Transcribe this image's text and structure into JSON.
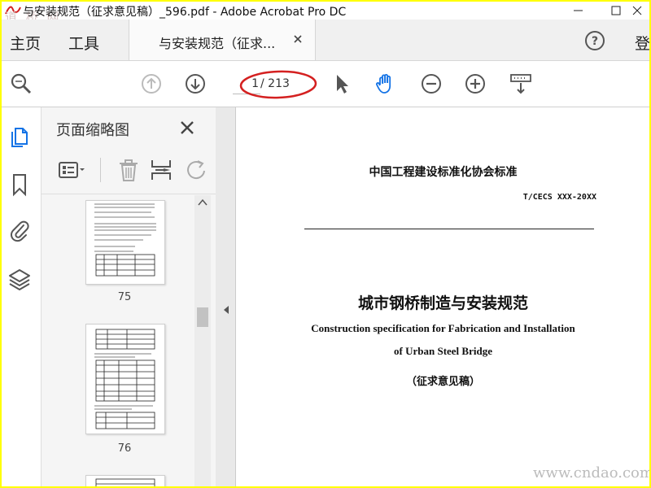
{
  "window": {
    "title": "与安装规范（征求意见稿）_596.pdf - Adobe Acrobat Pro DC"
  },
  "tabs": {
    "home": "主页",
    "tools": "工具",
    "document": "与安装规范（征求...",
    "sign_in": "登"
  },
  "toolbar": {
    "current_page": "1",
    "total_pages": "/ 213"
  },
  "sidebar": {
    "rail_icons": [
      "pages-icon",
      "bookmark-icon",
      "attachment-icon",
      "layers-icon"
    ],
    "panel_title": "页面缩略图",
    "thumbnails": [
      {
        "number": "75"
      },
      {
        "number": "76"
      }
    ]
  },
  "document": {
    "organization": "中国工程建设标准化协会标准",
    "code": "T/CECS XXX-20XX",
    "title_cn": "城市钢桥制造与安装规范",
    "title_en_line1": "Construction specification for Fabrication and Installation",
    "title_en_line2": "of Urban Steel Bridge",
    "subtitle": "（征求意见稿）"
  },
  "watermarks": {
    "top_left": "道 桥 网",
    "bottom_right": "www.cndao.com"
  },
  "colors": {
    "border": "#ffff00",
    "annotation_ellipse": "#d42020",
    "hand_tool_active": "#1473e6"
  }
}
